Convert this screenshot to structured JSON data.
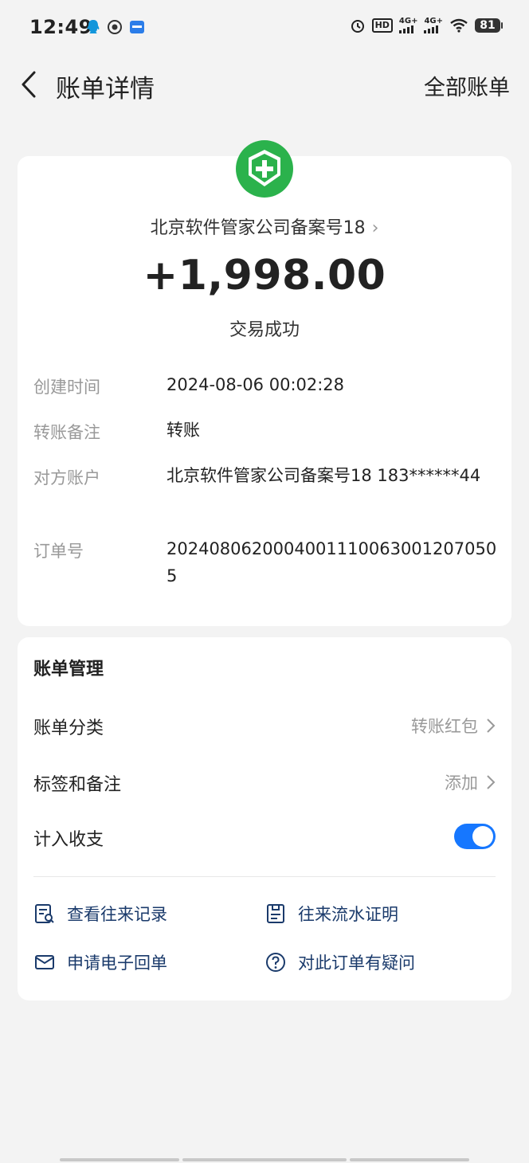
{
  "status_bar": {
    "time": "12:49",
    "battery": "81",
    "hd": "HD",
    "signal1": "4G+",
    "signal2": "4G+"
  },
  "nav": {
    "title": "账单详情",
    "right_action": "全部账单"
  },
  "transaction": {
    "merchant": "北京软件管家公司备案号18",
    "amount": "+1,998.00",
    "status": "交易成功",
    "details": [
      {
        "label": "创建时间",
        "value": "2024-08-06 00:02:28"
      },
      {
        "label": "转账备注",
        "value": "转账"
      },
      {
        "label": "对方账户",
        "value": "北京软件管家公司备案号18 183******44"
      },
      {
        "label": "订单号",
        "value": "20240806200040011100630012070505"
      }
    ]
  },
  "manage": {
    "title": "账单管理",
    "rows": [
      {
        "label": "账单分类",
        "value": "转账红包"
      },
      {
        "label": "标签和备注",
        "value": "添加"
      },
      {
        "label": "计入收支",
        "toggle_on": true
      }
    ],
    "actions": [
      {
        "label": "查看往来记录",
        "icon": "record-search-icon"
      },
      {
        "label": "往来流水证明",
        "icon": "statement-icon"
      },
      {
        "label": "申请电子回单",
        "icon": "mail-icon"
      },
      {
        "label": "对此订单有疑问",
        "icon": "question-icon"
      }
    ]
  },
  "colors": {
    "accent": "#1677ff",
    "logo_green": "#2bb24c",
    "action_text": "#1a3a6b"
  }
}
